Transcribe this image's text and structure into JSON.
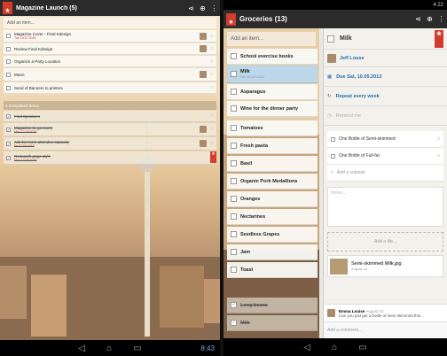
{
  "left": {
    "app_title": "Magazine Launch (5)",
    "add_placeholder": "Add an item...",
    "tasks": [
      {
        "title": "Magazine Cover - Final Kdesign",
        "sub": "Tue 14.07.2015",
        "done": false,
        "avatar": true
      },
      {
        "title": "Review Final Kdesign",
        "sub": "",
        "done": false,
        "avatar": true
      },
      {
        "title": "Organize a Party Location",
        "sub": "",
        "done": false,
        "avatar": false
      },
      {
        "title": "Music",
        "sub": "",
        "done": false,
        "avatar": true
      },
      {
        "title": "Send of Banners to printers",
        "sub": "",
        "done": false,
        "avatar": false
      }
    ],
    "completed_label": "4 Completed Items",
    "completed": [
      {
        "title": "Find Speakers",
        "sub": "",
        "avatar": false
      },
      {
        "title": "Magazine to-go every",
        "sub": "Mon 17.08.2015",
        "avatar": true
      },
      {
        "title": "Ask for more attendee capacity",
        "sub": "Fri 17.09.2015",
        "avatar": true
      },
      {
        "title": "Research page style",
        "sub": "Mon 17.08.2015",
        "avatar": false
      }
    ],
    "clock": "8:43"
  },
  "right": {
    "status_time": "4:22",
    "app_title": "Groceries (13)",
    "add_placeholder": "Add an item...",
    "tasks": [
      {
        "title": "School exercise books",
        "sub": "",
        "selected": false,
        "done": false
      },
      {
        "title": "Milk",
        "sub": "Sat 10.05.2013",
        "selected": true,
        "done": false
      },
      {
        "title": "Asparagus",
        "sub": "",
        "selected": false,
        "done": false
      },
      {
        "title": "Wine for the dinner party",
        "sub": "",
        "selected": false,
        "done": false
      },
      {
        "title": "Tomatoes",
        "sub": "",
        "selected": false,
        "done": false
      },
      {
        "title": "Fresh pasta",
        "sub": "",
        "selected": false,
        "done": false
      },
      {
        "title": "Basil",
        "sub": "",
        "selected": false,
        "done": false
      },
      {
        "title": "Organic Pork Medallions",
        "sub": "",
        "selected": false,
        "done": false
      },
      {
        "title": "Oranges",
        "sub": "",
        "selected": false,
        "done": false
      },
      {
        "title": "Nectarines",
        "sub": "",
        "selected": false,
        "done": false
      },
      {
        "title": "Seedless Grapes",
        "sub": "",
        "selected": false,
        "done": false
      },
      {
        "title": "Jam",
        "sub": "",
        "selected": false,
        "done": false
      },
      {
        "title": "Toast",
        "sub": "",
        "selected": false,
        "done": false
      }
    ],
    "completed": [
      {
        "title": "Long beans",
        "done": true
      },
      {
        "title": "Milk",
        "done": true
      }
    ],
    "detail": {
      "title": "Milk",
      "assignee": "Jeff Louse",
      "due": "Due Sat, 10.05.2013",
      "repeat": "Repeat every week",
      "reminder": "Remind me",
      "subtasks": [
        "One Bottle of Semi-skimmed",
        "One Bottle of Full-fat"
      ],
      "add_subtask": "Add a subtask",
      "notes_placeholder": "Notes...",
      "add_file": "Add a file...",
      "file_name": "Semi-skimmed Milk.jpg",
      "file_date": "August 10",
      "comment_author": "Emma Louise",
      "comment_date": "August 10",
      "comment_text": "Can you just get a bottle of semi-skimmed this...",
      "add_comment": "Add a comment..."
    }
  },
  "colors": {
    "accent": "#d33b2d",
    "selected": "#bcd6ea",
    "link": "#2a6cb3"
  }
}
